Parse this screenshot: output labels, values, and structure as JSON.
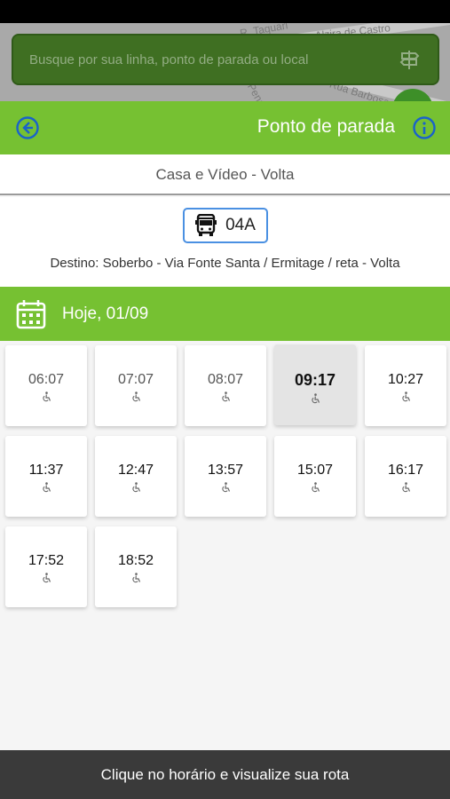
{
  "map": {
    "street_labels": [
      "R. Taquari",
      "Rua Alzira de Castro",
      "Rua Barbosa",
      "Rua",
      "Pena"
    ]
  },
  "search": {
    "placeholder": "Busque por sua linha, ponto de parada ou local",
    "icon": "signpost-icon"
  },
  "header": {
    "title": "Ponto de parada",
    "back_icon": "back-arrow-icon",
    "info_icon": "info-icon"
  },
  "stop": {
    "name": "Casa e Vídeo - Volta"
  },
  "line": {
    "code": "04A",
    "icon": "bus-icon",
    "destino": "Destino: Soberbo - Via Fonte Santa / Ermitage / reta - Volta"
  },
  "date": {
    "label": "Hoje, 01/09",
    "icon": "calendar-icon"
  },
  "schedule": [
    {
      "time": "06:07",
      "state": "past"
    },
    {
      "time": "07:07",
      "state": "past"
    },
    {
      "time": "08:07",
      "state": "past"
    },
    {
      "time": "09:17",
      "state": "selected"
    },
    {
      "time": "10:27",
      "state": "upcoming"
    },
    {
      "time": "11:37",
      "state": "upcoming"
    },
    {
      "time": "12:47",
      "state": "upcoming"
    },
    {
      "time": "13:57",
      "state": "upcoming"
    },
    {
      "time": "15:07",
      "state": "upcoming"
    },
    {
      "time": "16:17",
      "state": "upcoming"
    },
    {
      "time": "17:52",
      "state": "upcoming"
    },
    {
      "time": "18:52",
      "state": "upcoming"
    }
  ],
  "footer": {
    "text": "Clique no horário e visualize sua rota"
  },
  "colors": {
    "accent_green": "#76c132",
    "line_badge_border": "#4a90e2",
    "footer_bg": "#3a3a3a"
  }
}
